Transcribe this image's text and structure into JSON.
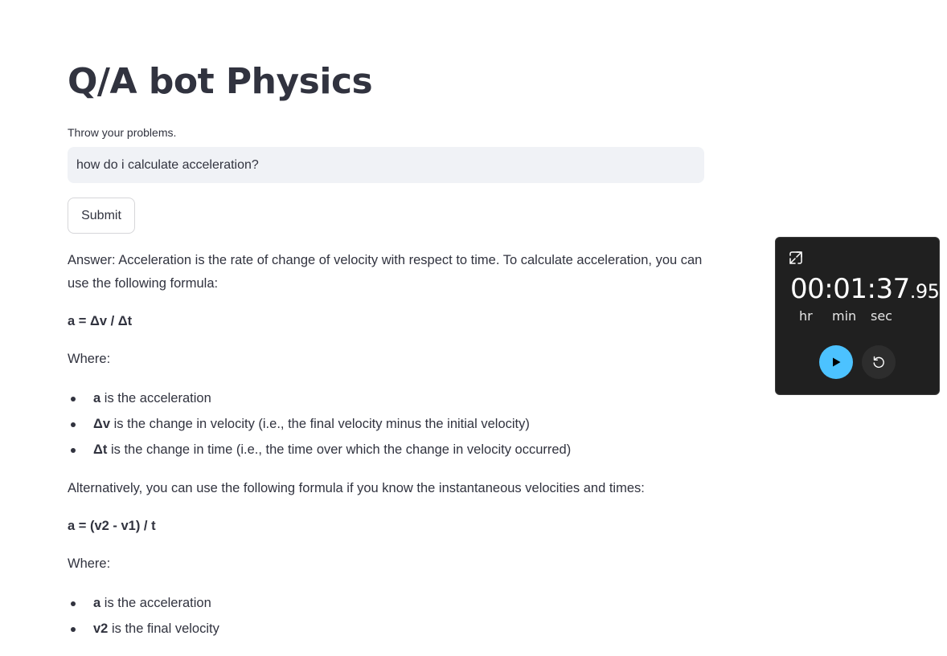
{
  "page": {
    "title": "Q/A bot Physics",
    "input_label": "Throw your problems.",
    "input_value": "how do i calculate acceleration?",
    "submit_label": "Submit"
  },
  "answer": {
    "intro": "Answer: Acceleration is the rate of change of velocity with respect to time. To calculate acceleration, you can use the following formula:",
    "formula1": "a = Δv / Δt",
    "where1": "Where:",
    "list1": [
      {
        "term": "a",
        "desc": " is the acceleration"
      },
      {
        "term": "Δv",
        "desc": " is the change in velocity (i.e., the final velocity minus the initial velocity)"
      },
      {
        "term": "Δt",
        "desc": " is the change in time (i.e., the time over which the change in velocity occurred)"
      }
    ],
    "alt": "Alternatively, you can use the following formula if you know the instantaneous velocities and times:",
    "formula2": "a = (v2 - v1) / t",
    "where2": "Where:",
    "list2": [
      {
        "term": "a",
        "desc": " is the acceleration"
      },
      {
        "term": "v2",
        "desc": " is the final velocity"
      }
    ]
  },
  "timer": {
    "time_main": "00:01:37",
    "time_fraction": ".95",
    "unit_hr": "hr",
    "unit_min": "min",
    "unit_sec": "sec",
    "play_color": "#4cc2ff",
    "expand_icon": "expand-icon",
    "play_icon": "play-icon",
    "reset_icon": "reset-icon"
  }
}
